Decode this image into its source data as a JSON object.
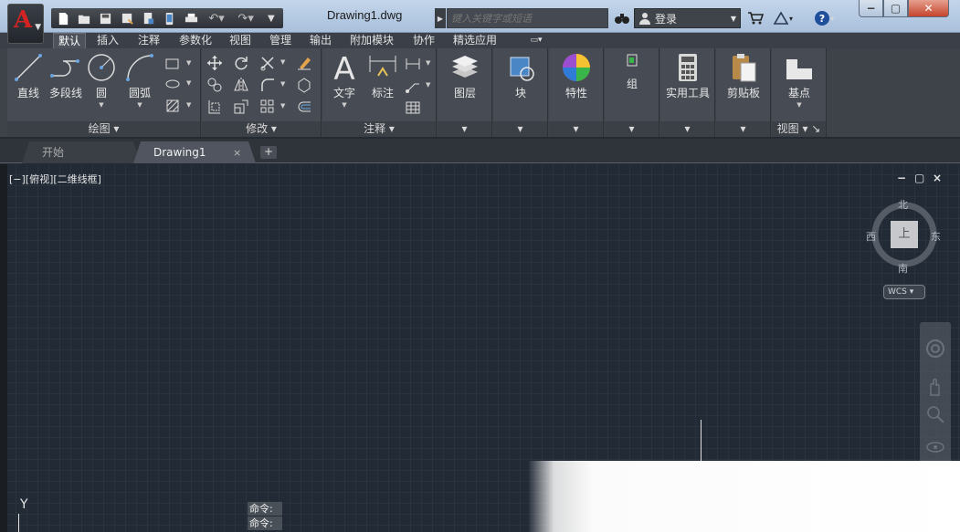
{
  "title": "Drawing1.dwg",
  "app_logo": "A",
  "quick_access": [
    "new-icon",
    "open-icon",
    "save-icon",
    "save-as-icon",
    "open-from-web-icon",
    "save-to-web-icon",
    "plot-icon",
    "undo-icon",
    "redo-icon",
    "customize-icon"
  ],
  "search": {
    "placeholder": "键入关键字或短语"
  },
  "signin": {
    "label": "登录"
  },
  "ribbon_tabs": [
    "默认",
    "插入",
    "注释",
    "参数化",
    "视图",
    "管理",
    "输出",
    "附加模块",
    "协作",
    "精选应用"
  ],
  "ribbon_panels": {
    "draw": {
      "title": "绘图",
      "buttons": [
        "直线",
        "多段线",
        "圆",
        "圆弧"
      ]
    },
    "modify": {
      "title": "修改"
    },
    "annotation": {
      "title": "注释",
      "buttons": [
        "文字",
        "标注"
      ]
    },
    "layers": {
      "label": "图层"
    },
    "block": {
      "label": "块"
    },
    "properties": {
      "label": "特性"
    },
    "group": {
      "label": "组"
    },
    "utilities": {
      "label": "实用工具"
    },
    "clipboard": {
      "label": "剪贴板"
    },
    "view": {
      "title": "视图",
      "buttons": [
        "基点"
      ]
    }
  },
  "file_tabs": {
    "start": "开始",
    "drawing": "Drawing1",
    "close": "×",
    "new": "+"
  },
  "viewport": {
    "label": "[−][俯视][二维线框]",
    "min": "−",
    "max": "▢",
    "close": "×"
  },
  "viewcube": {
    "north": "北",
    "south": "南",
    "east": "东",
    "west": "西",
    "top": "上",
    "wcs": "WCS ▾"
  },
  "ucs": {
    "y": "Y"
  },
  "command": {
    "line1": "命令:",
    "line2": "命令:"
  },
  "colors": {
    "canvas": "#222a35",
    "ribbon": "#474c54",
    "titlebar": "#b7cbe3"
  }
}
